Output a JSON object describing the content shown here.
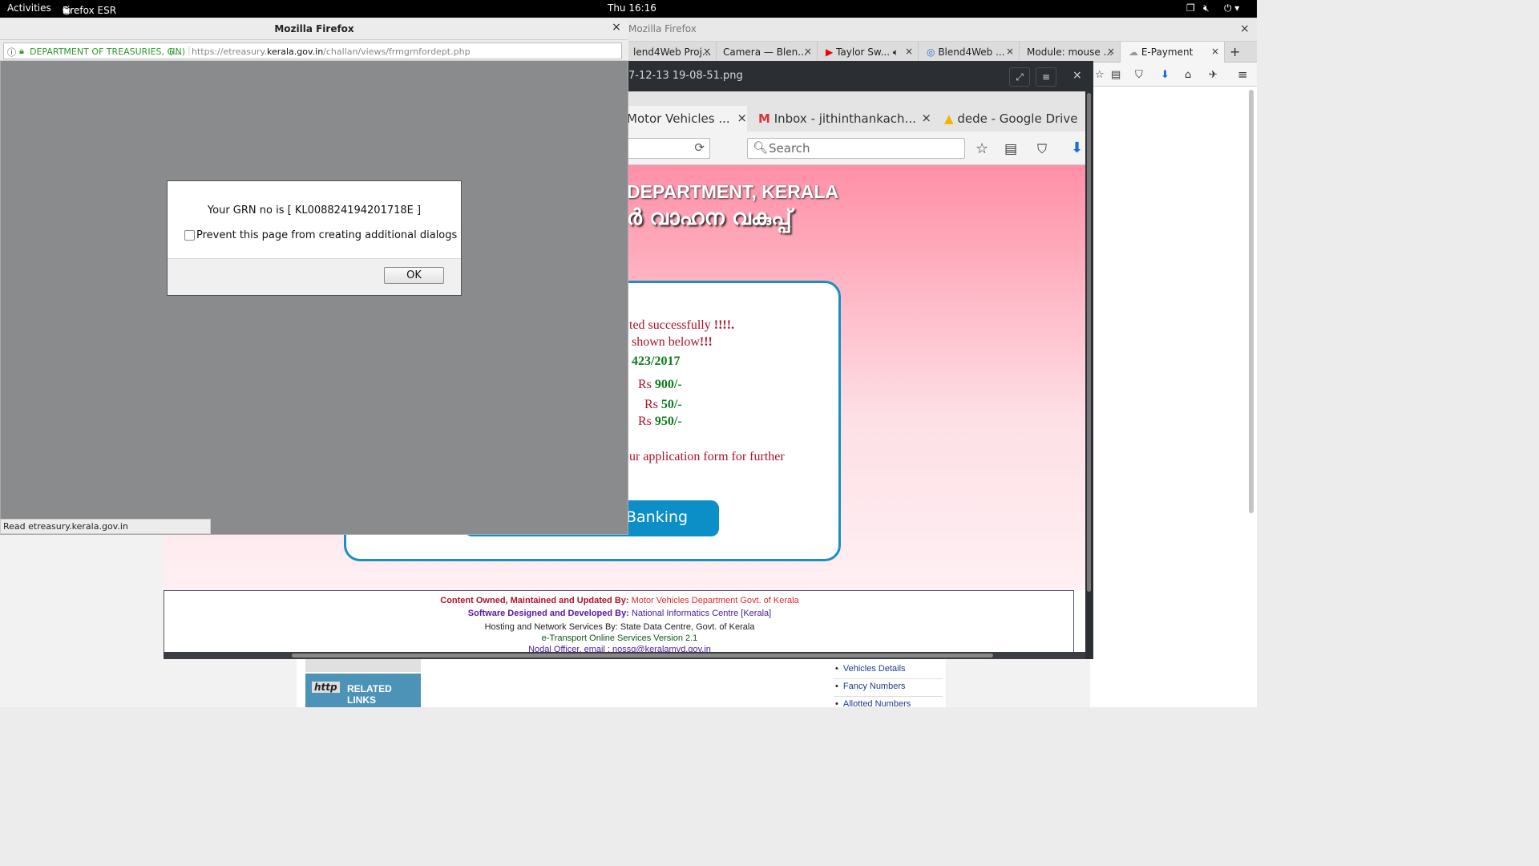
{
  "topbar": {
    "activities": "Activities",
    "app_menu": "Firefox ESR",
    "clock": "Thu 16:16"
  },
  "bg_window": {
    "title": "Mozilla Firefox",
    "tabs": [
      {
        "label": "lend4Web Proj..."
      },
      {
        "label": "Camera — Blen..."
      },
      {
        "label": "Taylor Sw..."
      },
      {
        "label": "Blend4Web ..."
      },
      {
        "label": "Module: mouse ..."
      },
      {
        "label": "E-Payment"
      }
    ],
    "links": [
      "Vehicles Details",
      "Fancy Numbers",
      "Allotted Numbers"
    ],
    "related_links": "RELATED LINKS",
    "related_http": "http"
  },
  "viewer": {
    "title": "7-12-13 19-08-51.png",
    "tabs": [
      {
        "label": "Motor Vehicles ..."
      },
      {
        "label": "Inbox - jithinthankach..."
      },
      {
        "label": "dede - Google Drive"
      }
    ],
    "search_placeholder": "Search",
    "header_en": "DEPARTMENT, KERALA",
    "header_ml": "ർ വാഹന വകുപ്പ്",
    "lines": {
      "success": "ted successfully",
      "success_mark": "!!!!.",
      "shown": "shown below",
      "shown_mark": "!!!",
      "app_no": "423/2017",
      "rs1_label": "Rs",
      "rs1_value": "900/-",
      "rs2_label": "Rs",
      "rs2_value": "50/-",
      "rs3_label": "Rs",
      "rs3_value": "950/-",
      "further": "ur application form for further"
    },
    "bank_button": "Banking",
    "footer": {
      "l1_label": "Content Owned, Maintained and Updated By:",
      "l1_value": "Motor Vehicles Department Govt. of Kerala",
      "l2_label": "Software Designed and Developed By:",
      "l2_value": "National Informatics Centre [Kerala]",
      "l3": "Hosting and Network Services By: State Data Centre, Govt. of Kerala",
      "l4": "e-Transport Online Services Version 2.1",
      "l5": "Nodal Officer, email : nossg@keralamvd.gov.in"
    }
  },
  "popup": {
    "title": "Mozilla Firefox",
    "site_identity": "DEPARTMENT OF TREASURIES, G...",
    "country": "(IN)",
    "url_prefix": "https://etreasury.",
    "url_domain": "kerala.gov.in",
    "url_path": "/challan/views/frmgrnfordept.php",
    "status": "Read etreasury.kerala.gov.in"
  },
  "dialog": {
    "message": "Your GRN no is [ KL008824194201718E ]",
    "checkbox_label": "Prevent this page from creating additional dialogs",
    "ok": "OK"
  },
  "colors": {
    "accent_blue": "#0c8ec7",
    "kerala_red": "#b0122a",
    "kerala_green": "#0d7d1e"
  }
}
